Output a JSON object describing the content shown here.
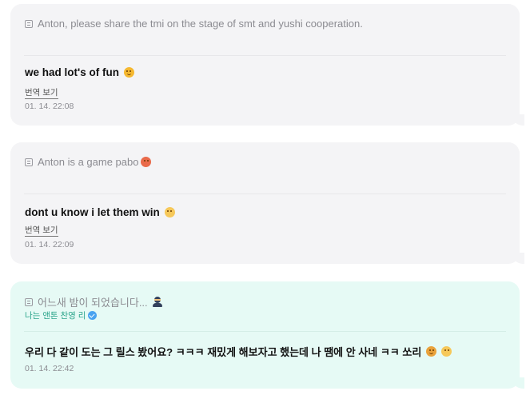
{
  "messages": [
    {
      "quote": "Anton, please share the tmi on the stage of smt and yushi cooperation.",
      "text": "we had lot's of fun",
      "emoji": "smiling-face-icon",
      "translate": "번역 보기",
      "time": "01. 14. 22:08"
    },
    {
      "quote": "Anton is a game pabo",
      "quote_emoji": "pouting-face-icon",
      "text": "dont u know i let them win",
      "emoji": "flushed-face-icon",
      "translate": "번역 보기",
      "time": "01. 14. 22:09"
    },
    {
      "quote": "어느새 밤이 되었습니다...",
      "quote_emoji": "ninja-icon",
      "sender": "나는 앤톤 찬영 리",
      "text": "우리 다 같이 도는 그 릴스 봤어요? ㅋㅋㅋ 재밌게 해보자고 했는데 나 땜에 안 사네 ㅋㅋ 쏘리",
      "emoji": "nerd-face-icon",
      "emoji2": "sneezing-face-icon",
      "time": "01. 14. 22:42"
    }
  ],
  "colors": {
    "bubble_grey": "#f4f4f6",
    "bubble_mint": "#e6faf5",
    "verified": "#4aa3f0"
  }
}
